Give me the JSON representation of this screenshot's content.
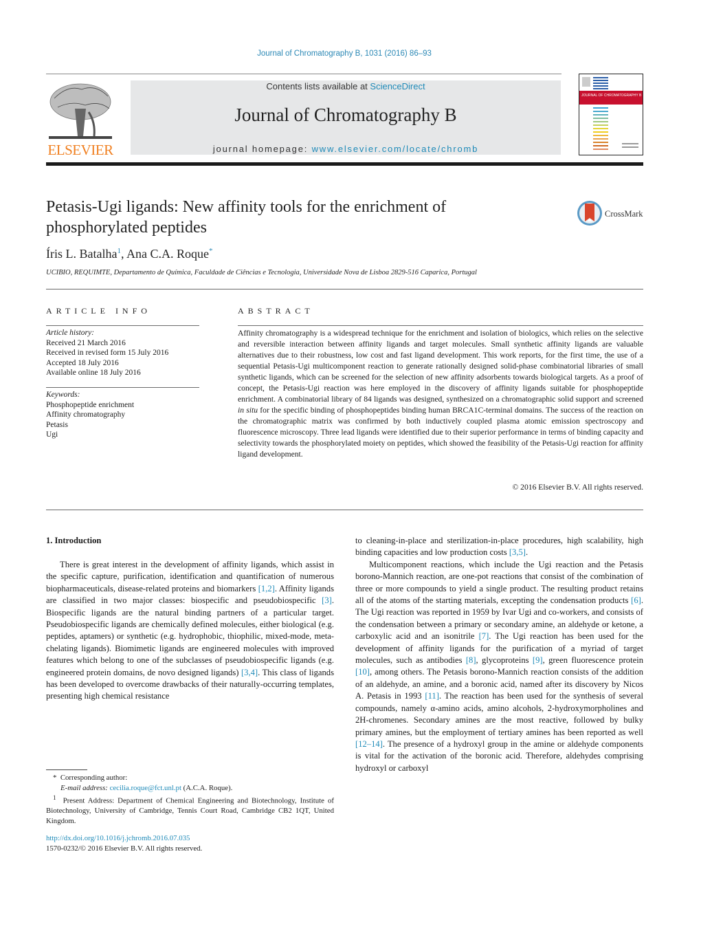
{
  "header": {
    "citation": "Journal of Chromatography B, 1031 (2016) 86–93",
    "publisher_wordmark": "ELSEVIER",
    "contents_prefix": "Contents lists available at ",
    "contents_link": "ScienceDirect",
    "journal_title": "Journal of Chromatography B",
    "homepage_prefix": "journal homepage: ",
    "homepage_link": "www.elsevier.com/locate/chromb",
    "cover_title": "JOURNAL OF CHROMATOGRAPHY B"
  },
  "article": {
    "title": "Petasis-Ugi ligands: New affinity tools for the enrichment of phosphorylated peptides",
    "crossmark_label": "CrossMark",
    "authors": [
      {
        "name": "Íris L. Batalha",
        "mark": "1"
      },
      {
        "name": "Ana C.A. Roque",
        "mark": "*"
      }
    ],
    "author_separator": ", ",
    "affiliation": "UCIBIO, REQUIMTE, Departamento de Química, Faculdade de Ciências e Tecnologia, Universidade Nova de Lisboa 2829-516 Caparica, Portugal"
  },
  "article_info": {
    "heading": "ARTICLE INFO",
    "history_label": "Article history:",
    "history": [
      "Received 21 March 2016",
      "Received in revised form 15 July 2016",
      "Accepted 18 July 2016",
      "Available online 18 July 2016"
    ],
    "keywords_label": "Keywords:",
    "keywords": [
      "Phosphopeptide enrichment",
      "Affinity chromatography",
      "Petasis",
      "Ugi"
    ]
  },
  "abstract": {
    "heading": "ABSTRACT",
    "text_1": "Affinity chromatography is a widespread technique for the enrichment and isolation of biologics, which relies on the selective and reversible interaction between affinity ligands and target molecules. Small synthetic affinity ligands are valuable alternatives due to their robustness, low cost and fast ligand development. This work reports, for the first time, the use of a sequential Petasis-Ugi multicomponent reaction to generate rationally designed solid-phase combinatorial libraries of small synthetic ligands, which can be screened for the selection of new affinity adsorbents towards biological targets. As a proof of concept, the Petasis-Ugi reaction was here employed in the discovery of affinity ligands suitable for phosphopeptide enrichment. A combinatorial library of 84 ligands was designed, synthesized on a chromatographic solid support and screened ",
    "text_italic": "in situ",
    "text_2": " for the specific binding of phosphopeptides binding human BRCA1C-terminal domains. The success of the reaction on the chromatographic matrix was confirmed by both inductively coupled plasma atomic emission spectroscopy and fluorescence microscopy. Three lead ligands were identified due to their superior performance in terms of binding capacity and selectivity towards the phosphorylated moiety on peptides, which showed the feasibility of the Petasis-Ugi reaction for affinity ligand development.",
    "copyright": "© 2016 Elsevier B.V. All rights reserved."
  },
  "body": {
    "section_heading": "1.  Introduction",
    "p1": [
      {
        "t": "There is great interest in the development of affinity ligands, which assist in the specific capture, purification, identification and quantification of numerous biopharmaceuticals, disease-related proteins and biomarkers "
      },
      {
        "c": "[1,2]"
      },
      {
        "t": ". Affinity ligands are classified in two major classes: biospecific and pseudobiospecific "
      },
      {
        "c": "[3]"
      },
      {
        "t": ". Biospecific ligands are the natural binding partners of a particular target. Pseudobiospecific ligands are chemically defined molecules, either biological (e.g. peptides, aptamers) or synthetic (e.g. hydrophobic, thiophilic, mixed-mode, meta-chelating ligands). Biomimetic ligands are engineered molecules with improved features which belong to one of the subclasses of pseudobiospecific ligands (e.g. engineered protein domains, de novo designed ligands) "
      },
      {
        "c": "[3,4]"
      },
      {
        "t": ". This class of ligands has been developed to overcome drawbacks of their naturally-occurring templates, presenting high chemical resistance"
      }
    ],
    "p1_cont": [
      {
        "t": "to cleaning-in-place and sterilization-in-place procedures, high scalability, high binding capacities and low production costs "
      },
      {
        "c": "[3,5]"
      },
      {
        "t": "."
      }
    ],
    "p2": [
      {
        "t": "Multicomponent reactions, which include the Ugi reaction and the Petasis borono-Mannich reaction, are one-pot reactions that consist of the combination of three or more compounds to yield a single product. The resulting product retains all of the atoms of the starting materials, excepting the condensation products "
      },
      {
        "c": "[6]"
      },
      {
        "t": ". The Ugi reaction was reported in 1959 by Ivar Ugi and co-workers, and consists of the condensation between a primary or secondary amine, an aldehyde or ketone, a carboxylic acid and an isonitrile "
      },
      {
        "c": "[7]"
      },
      {
        "t": ". The Ugi reaction has been used for the development of affinity ligands for the purification of a myriad of target molecules, such as antibodies "
      },
      {
        "c": "[8]"
      },
      {
        "t": ", glycoproteins "
      },
      {
        "c": "[9]"
      },
      {
        "t": ", green fluorescence protein "
      },
      {
        "c": "[10]"
      },
      {
        "t": ", among others. The Petasis borono-Mannich reaction consists of the addition of an aldehyde, an amine, and a boronic acid, named after its discovery by Nicos A. Petasis in 1993 "
      },
      {
        "c": "[11]"
      },
      {
        "t": ". The reaction has been used for the synthesis of several compounds, namely α-amino acids, amino alcohols, 2-hydroxymorpholines and 2H-chromenes. Secondary amines are the most reactive, followed by bulky primary amines, but the employment of tertiary amines has been reported as well "
      },
      {
        "c": "[12–14]"
      },
      {
        "t": ". The presence of a hydroxyl group in the amine or aldehyde components is vital for the activation of the boronic acid. Therefore, aldehydes comprising hydroxyl or carboxyl"
      }
    ]
  },
  "footnotes": {
    "corr_mark": "*",
    "corr_label": "Corresponding author:",
    "email_label": "E-mail address:",
    "email": "cecilia.roque@fct.unl.pt",
    "email_suffix": " (A.C.A. Roque).",
    "addr_mark": "1",
    "addr_text": "Present Address: Department of Chemical Engineering and Biotechnology, Institute of Biotechnology, University of Cambridge, Tennis Court Road, Cambridge CB2 1QT, United Kingdom.",
    "doi": "http://dx.doi.org/10.1016/j.jchromb.2016.07.035",
    "issn_copyright": "1570-0232/© 2016 Elsevier B.V. All rights reserved."
  },
  "colors": {
    "link": "#1e8ab8",
    "elsevier_orange": "#f07f1f",
    "cover_red": "#c8102e"
  }
}
